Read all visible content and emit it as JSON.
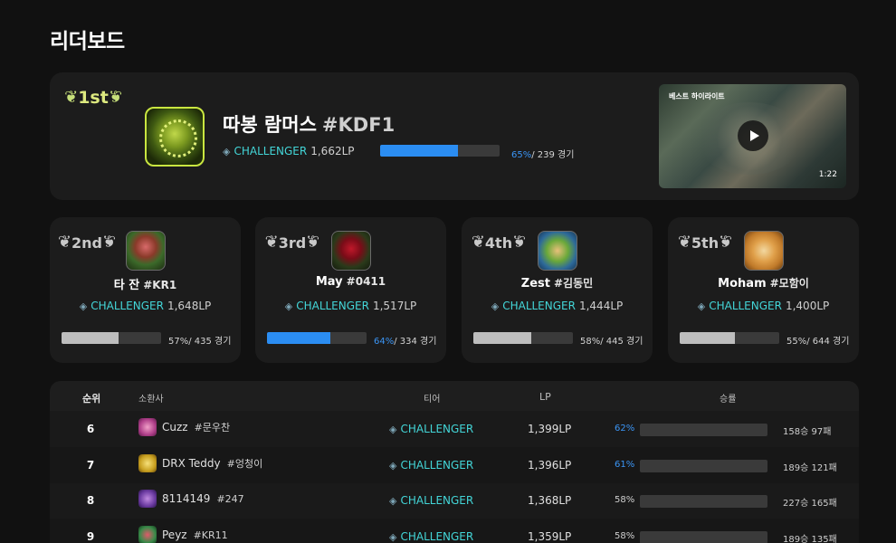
{
  "page": {
    "title": "리더보드"
  },
  "colors": {
    "background": "#111111",
    "card": "#1c1c1c",
    "tier": "#43d6d8",
    "accent_blue": "#2b8df2",
    "bar_gray": "#bdbdbd",
    "gold_border": "#c9e640"
  },
  "first": {
    "rank_label": "1st",
    "name": "따봉 람머스",
    "tag": "#KDF1",
    "tier": "CHALLENGER",
    "lp": "1,662LP",
    "win_rate": 65,
    "win_rate_label": "65%",
    "games_label": "/ 239 경기",
    "video": {
      "label": "베스트 하이라이트",
      "duration": "1:22"
    }
  },
  "runners": [
    {
      "rank_label": "2nd",
      "name": "타 잔",
      "tag": "#KR1",
      "tier": "CHALLENGER",
      "lp": "1,648LP",
      "win_rate": 57,
      "win_rate_label": "57%",
      "games_label": "/ 435 경기",
      "highlight": false
    },
    {
      "rank_label": "3rd",
      "name": "May",
      "tag": "#0411",
      "tier": "CHALLENGER",
      "lp": "1,517LP",
      "win_rate": 64,
      "win_rate_label": "64%",
      "games_label": "/ 334 경기",
      "highlight": true
    },
    {
      "rank_label": "4th",
      "name": "Zest",
      "tag": "#김동민",
      "tier": "CHALLENGER",
      "lp": "1,444LP",
      "win_rate": 58,
      "win_rate_label": "58%",
      "games_label": "/ 445 경기",
      "highlight": false
    },
    {
      "rank_label": "5th",
      "name": "Moham",
      "tag": "#모함이",
      "tier": "CHALLENGER",
      "lp": "1,400LP",
      "win_rate": 55,
      "win_rate_label": "55%",
      "games_label": "/ 644 경기",
      "highlight": false
    }
  ],
  "table": {
    "headers": {
      "rank": "순위",
      "summoner": "소환사",
      "tier": "티어",
      "lp": "LP",
      "winrate": "승률"
    },
    "rows": [
      {
        "rank": "6",
        "name": "Cuzz",
        "tag": "#문우찬",
        "tier": "CHALLENGER",
        "lp": "1,399LP",
        "win_rate": 62,
        "win_rate_label": "62%",
        "record": "158승 97패",
        "highlight": true
      },
      {
        "rank": "7",
        "name": "DRX Teddy",
        "tag": "#엉청이",
        "tier": "CHALLENGER",
        "lp": "1,396LP",
        "win_rate": 61,
        "win_rate_label": "61%",
        "record": "189승 121패",
        "highlight": true
      },
      {
        "rank": "8",
        "name": "8114149",
        "tag": "#247",
        "tier": "CHALLENGER",
        "lp": "1,368LP",
        "win_rate": 58,
        "win_rate_label": "58%",
        "record": "227승 165패",
        "highlight": false
      },
      {
        "rank": "9",
        "name": "Peyz",
        "tag": "#KR11",
        "tier": "CHALLENGER",
        "lp": "1,359LP",
        "win_rate": 58,
        "win_rate_label": "58%",
        "record": "189승 135패",
        "highlight": false
      }
    ]
  }
}
